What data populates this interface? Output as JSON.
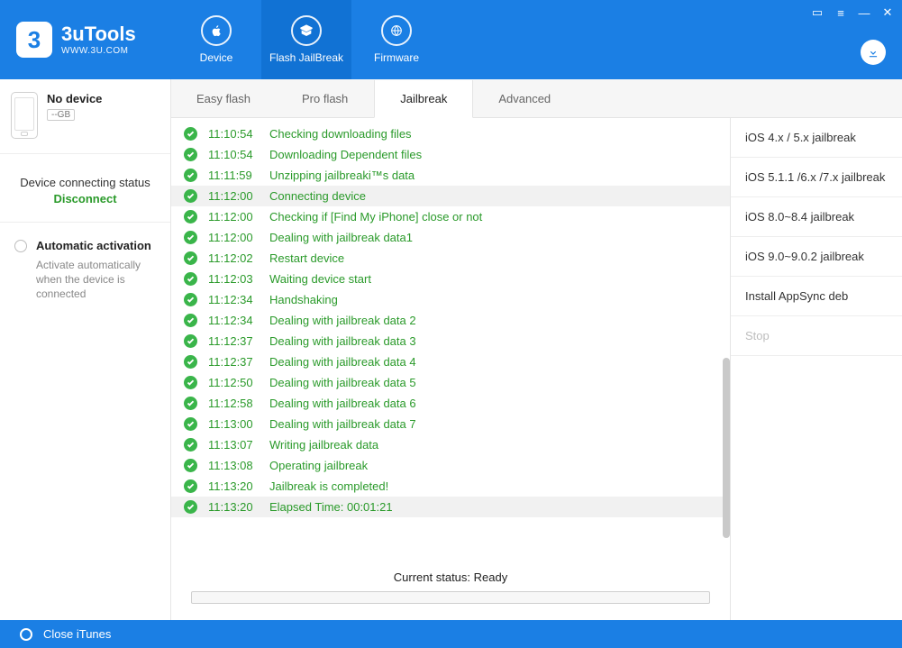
{
  "app": {
    "name": "3uTools",
    "site": "WWW.3U.COM"
  },
  "topnav": [
    {
      "label": "Device"
    },
    {
      "label": "Flash JailBreak"
    },
    {
      "label": "Firmware"
    }
  ],
  "device": {
    "name": "No device",
    "size": "--GB"
  },
  "conn": {
    "title": "Device connecting status",
    "action": "Disconnect"
  },
  "auto": {
    "title": "Automatic activation",
    "desc": "Activate automatically when the device is connected"
  },
  "tabs": [
    {
      "label": "Easy flash"
    },
    {
      "label": "Pro flash"
    },
    {
      "label": "Jailbreak"
    },
    {
      "label": "Advanced"
    }
  ],
  "log": [
    {
      "time": "11:10:54",
      "msg": "Checking downloading files",
      "hl": false
    },
    {
      "time": "11:10:54",
      "msg": "Downloading Dependent files",
      "hl": false
    },
    {
      "time": "11:11:59",
      "msg": "Unzipping jailbreaki™s data",
      "hl": false
    },
    {
      "time": "11:12:00",
      "msg": "Connecting device",
      "hl": true
    },
    {
      "time": "11:12:00",
      "msg": "Checking if [Find My iPhone] close or not",
      "hl": false
    },
    {
      "time": "11:12:00",
      "msg": "Dealing with jailbreak data1",
      "hl": false
    },
    {
      "time": "11:12:02",
      "msg": "Restart device",
      "hl": false
    },
    {
      "time": "11:12:03",
      "msg": "Waiting device start",
      "hl": false
    },
    {
      "time": "11:12:34",
      "msg": "Handshaking",
      "hl": false
    },
    {
      "time": "11:12:34",
      "msg": "Dealing with jailbreak data 2",
      "hl": false
    },
    {
      "time": "11:12:37",
      "msg": "Dealing with jailbreak data 3",
      "hl": false
    },
    {
      "time": "11:12:37",
      "msg": "Dealing with jailbreak data 4",
      "hl": false
    },
    {
      "time": "11:12:50",
      "msg": "Dealing with jailbreak data 5",
      "hl": false
    },
    {
      "time": "11:12:58",
      "msg": "Dealing with jailbreak data 6",
      "hl": false
    },
    {
      "time": "11:13:00",
      "msg": "Dealing with jailbreak data 7",
      "hl": false
    },
    {
      "time": "11:13:07",
      "msg": "Writing jailbreak data",
      "hl": false
    },
    {
      "time": "11:13:08",
      "msg": "Operating jailbreak",
      "hl": false
    },
    {
      "time": "11:13:20",
      "msg": "Jailbreak is completed!",
      "hl": false
    },
    {
      "time": "11:13:20",
      "msg": "Elapsed Time: 00:01:21",
      "hl": true
    }
  ],
  "status": {
    "text": "Current status: Ready"
  },
  "right": [
    {
      "label": "iOS 4.x / 5.x jailbreak",
      "disabled": false
    },
    {
      "label": "iOS 5.1.1 /6.x /7.x jailbreak",
      "disabled": false
    },
    {
      "label": "iOS 8.0~8.4 jailbreak",
      "disabled": false
    },
    {
      "label": "iOS 9.0~9.0.2 jailbreak",
      "disabled": false
    },
    {
      "label": "Install AppSync deb",
      "disabled": false
    },
    {
      "label": "Stop",
      "disabled": true
    }
  ],
  "footer": {
    "label": "Close iTunes"
  }
}
